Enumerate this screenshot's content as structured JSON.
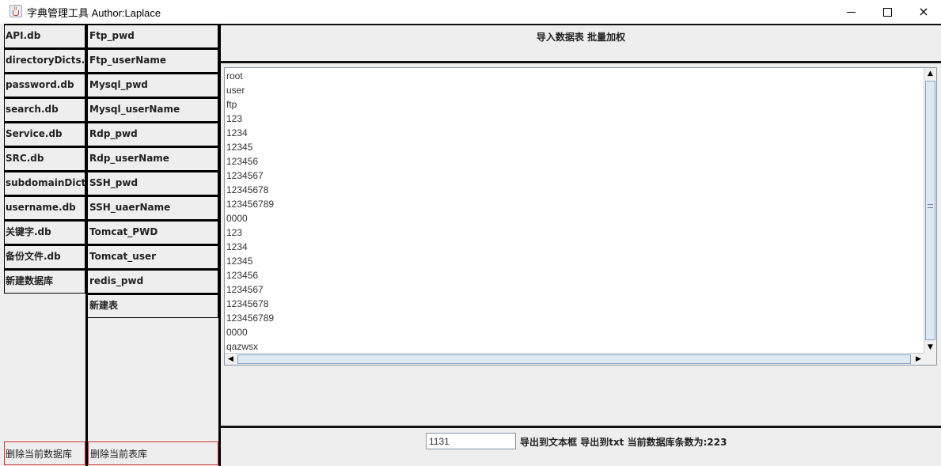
{
  "window": {
    "title": "字典管理工具 Author:Laplace",
    "controls": {
      "minimize": "minimize",
      "maximize": "maximize",
      "close": "×"
    }
  },
  "databases": {
    "items": [
      "API.db",
      "directoryDicts.db",
      "password.db",
      "search.db",
      "Service.db",
      "SRC.db",
      "subdomainDict.db",
      "username.db",
      "关键字.db",
      "备份文件.db",
      "新建数据库"
    ],
    "delete_label": "删除当前数据库"
  },
  "tables": {
    "items": [
      "Ftp_pwd",
      "Ftp_userName",
      "Mysql_pwd",
      "Mysql_userName",
      "Rdp_pwd",
      "Rdp_userName",
      "SSH_pwd",
      "SSH_uaerName",
      "Tomcat_PWD",
      "Tomcat_user",
      "redis_pwd",
      "新建表"
    ],
    "delete_label": "删除当前表库"
  },
  "top_actions": {
    "import_label": "导入数据表",
    "batch_label": "批量加权"
  },
  "content": {
    "lines": [
      "root",
      "user",
      "ftp",
      "123",
      "1234",
      "12345",
      "123456",
      "1234567",
      "12345678",
      "123456789",
      "0000",
      "123",
      "1234",
      "12345",
      "123456",
      "1234567",
      "12345678",
      "123456789",
      "0000",
      "qazwsx"
    ]
  },
  "bottom": {
    "input_value": "1131",
    "export_textbox_label": "导出到文本框",
    "export_txt_label": "导出到txt",
    "count_label": "当前数据库条数为:223"
  }
}
